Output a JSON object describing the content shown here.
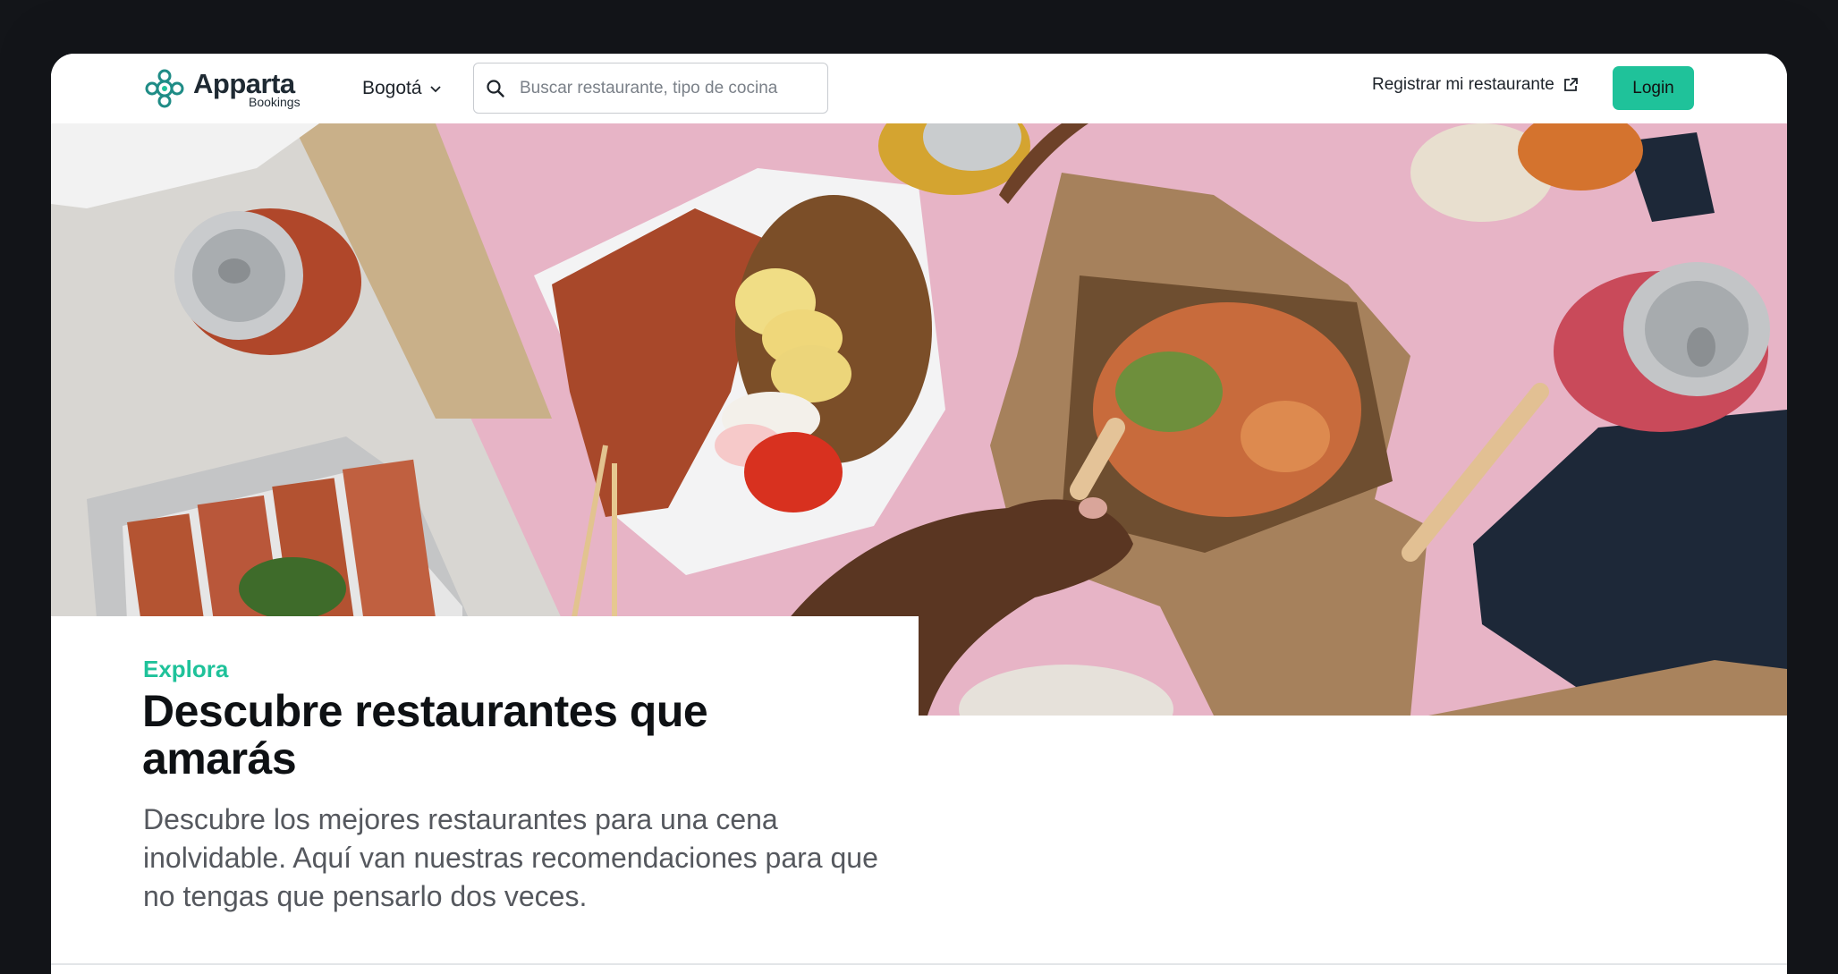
{
  "header": {
    "logo_word": "Apparta",
    "logo_sub": "Bookings",
    "city": "Bogotá",
    "search_placeholder": "Buscar restaurante, tipo de cocina",
    "register_label": "Registrar mi restaurante",
    "login_label": "Login"
  },
  "hero": {
    "image": "food-table-photo"
  },
  "intro": {
    "eyebrow": "Explora",
    "headline": "Descubre restaurantes que amarás",
    "description": "Descubre los mejores restaurantes para una cena inolvidable. Aquí van nuestras recomendaciones para que no tengas que pensarlo dos veces."
  },
  "icons": {
    "logo": "logo-mark-icon",
    "chevron": "chevron-down-icon",
    "search": "search-icon",
    "external": "external-link-icon"
  },
  "colors": {
    "accent": "#1fc29a",
    "frame": "#121418",
    "text": "#0e1114",
    "muted": "#55585e"
  }
}
